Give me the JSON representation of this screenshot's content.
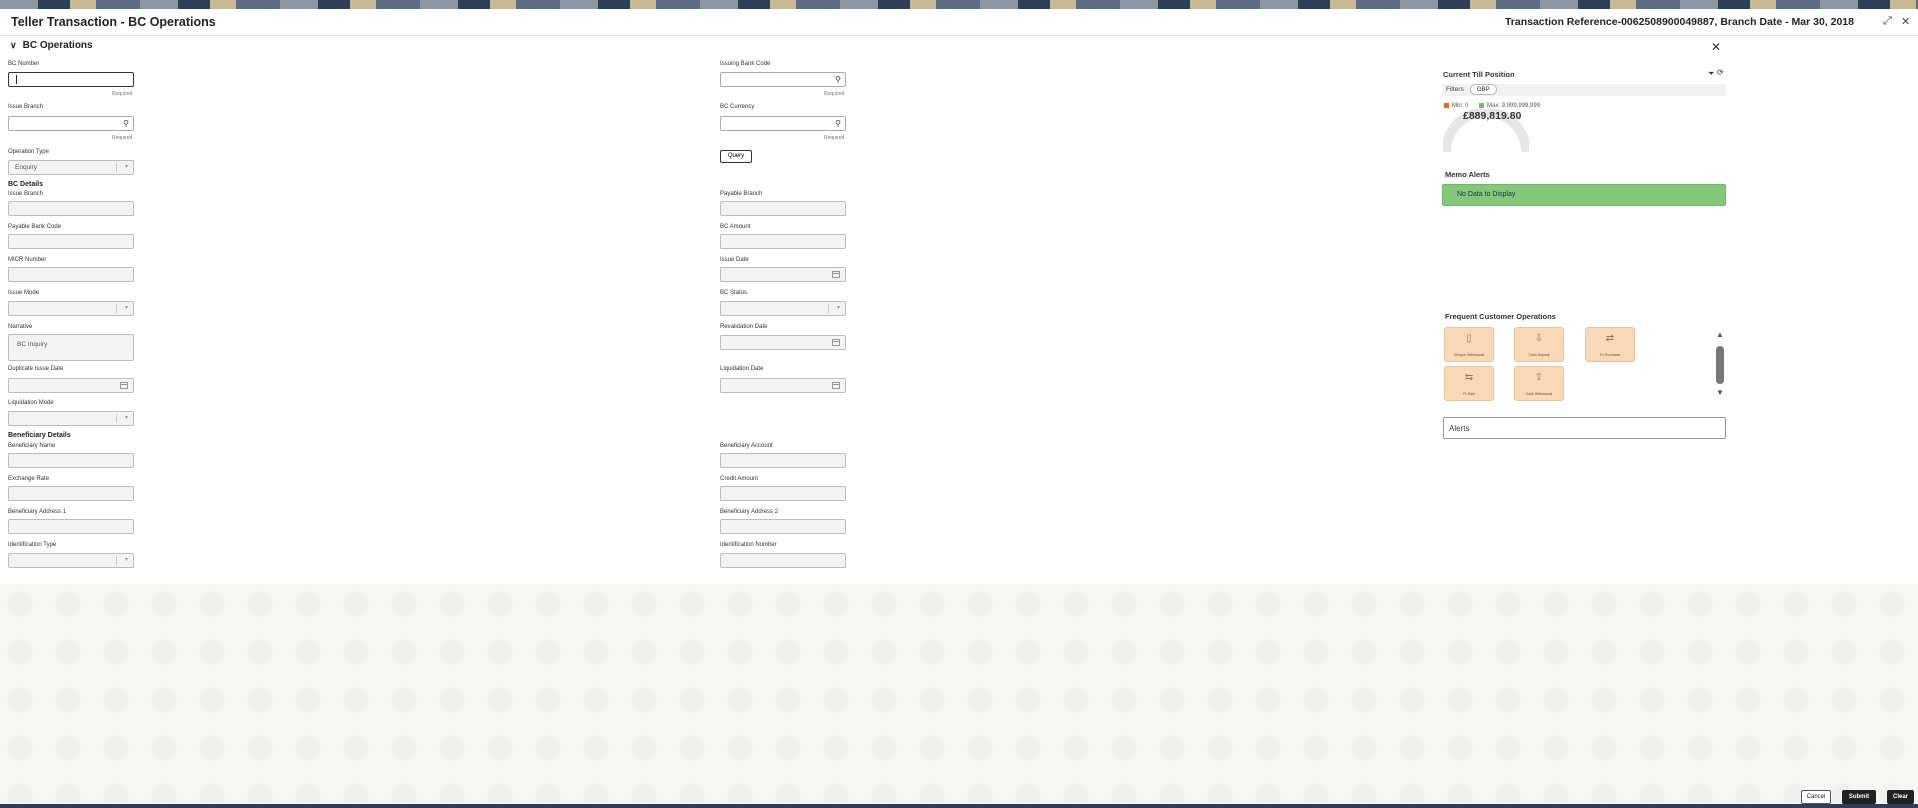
{
  "header": {
    "title": "Teller Transaction - BC Operations",
    "reference": "Transaction Reference-0062508900049887, Branch Date - Mar 30, 2018"
  },
  "section": {
    "title": "BC Operations"
  },
  "form": {
    "bc_number": {
      "label": "BC Number",
      "required": "Required",
      "value": ""
    },
    "issuing_bank_code": {
      "label": "Issuing Bank Code",
      "required": "Required",
      "value": ""
    },
    "issue_branch": {
      "label": "Issue Branch",
      "required": "Required",
      "value": ""
    },
    "bc_currency": {
      "label": "BC Currency",
      "required": "Required",
      "value": ""
    },
    "operation_type": {
      "label": "Operation Type",
      "value": "Enquiry"
    },
    "query_button": "Query"
  },
  "bc_details": {
    "title": "BC Details",
    "issue_branch": "Issue Branch",
    "payable_branch": "Payable Branch",
    "payable_bank_code": "Payable Bank Code",
    "bc_amount": "BC Amount",
    "micr_number": "MICR Number",
    "issue_date": "Issue Date",
    "issue_mode": "Issue Mode",
    "bc_status": "BC Status",
    "narrative": "Narrative",
    "narrative_value": "BC Inquiry",
    "revalidation_date": "Revalidation Date",
    "duplicate_issue_date": "Duplicate Issue Date",
    "liquidation_date": "Liquidation Date",
    "liquidation_mode": "Liquidation Mode"
  },
  "beneficiary": {
    "title": "Beneficiary Details",
    "name": "Beneficiary Name",
    "account": "Beneficiary Account",
    "exchange_rate": "Exchange Rate",
    "credit_amount": "Credit Amount",
    "address1": "Beneficiary Address 1",
    "address2": "Beneficiary Address 2",
    "id_type": "Identification Type",
    "id_number": "Identification Number"
  },
  "till": {
    "title": "Current Till Position",
    "filters_label": "Filters",
    "currency_chip": "GBP",
    "min_label": "Min: 0",
    "max_label": "Max: 9,999,999,999",
    "amount": "£889,819.80",
    "min_color": "#e8692b",
    "max_color": "#6cbf62"
  },
  "memo": {
    "title": "Memo Alerts",
    "empty": "No Data to Display",
    "color": "#83c878"
  },
  "frequent": {
    "title": "Frequent Customer Operations",
    "tiles": [
      {
        "label": "Cheque Withdrawal",
        "icon": "cheque-icon"
      },
      {
        "label": "Cash Deposit",
        "icon": "cash-deposit-icon"
      },
      {
        "label": "Fx Purchase",
        "icon": "fx-purchase-icon"
      },
      {
        "label": "Fx Sale",
        "icon": "fx-sale-icon"
      },
      {
        "label": "Cash Withdrawal",
        "icon": "cash-withdrawal-icon"
      }
    ]
  },
  "alerts": {
    "label": "Alerts"
  },
  "footer": {
    "cancel": "Cancel",
    "submit": "Submit",
    "clear": "Clear"
  }
}
